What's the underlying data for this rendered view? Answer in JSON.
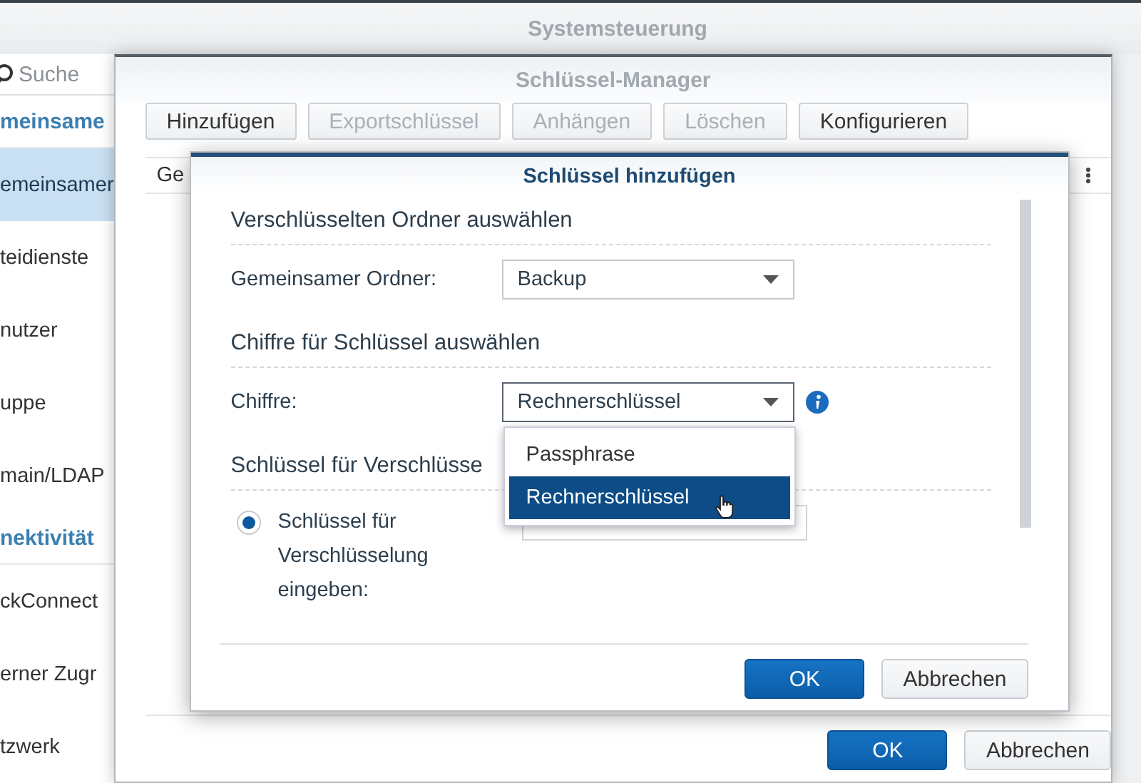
{
  "window": {
    "title": "Systemsteuerung"
  },
  "sidebar": {
    "search": {
      "placeholder": "Suche"
    },
    "items": [
      {
        "label": "meinsame",
        "kind": "header"
      },
      {
        "label": "emeinsamer",
        "kind": "item",
        "selected": true
      },
      {
        "label": "teidienste",
        "kind": "item",
        "selected": false
      },
      {
        "label": "nutzer",
        "kind": "item",
        "selected": false
      },
      {
        "label": "uppe",
        "kind": "item",
        "selected": false
      },
      {
        "label": "main/LDAP",
        "kind": "item",
        "selected": false
      },
      {
        "label": "nektivität",
        "kind": "header"
      },
      {
        "label": "ckConnect",
        "kind": "item",
        "selected": false
      },
      {
        "label": "erner Zugr",
        "kind": "item",
        "selected": false
      },
      {
        "label": "tzwerk",
        "kind": "item",
        "selected": false
      }
    ]
  },
  "key_manager": {
    "title": "Schlüssel-Manager",
    "toolbar": [
      {
        "label": "Hinzufügen",
        "disabled": false
      },
      {
        "label": "Exportschlüssel",
        "disabled": true
      },
      {
        "label": "Anhängen",
        "disabled": true
      },
      {
        "label": "Löschen",
        "disabled": true
      },
      {
        "label": "Konfigurieren",
        "disabled": false
      }
    ],
    "table": {
      "columns": [
        "Ge"
      ]
    },
    "buttons": [
      {
        "label": "OK",
        "kind": "primary"
      },
      {
        "label": "Abbrechen",
        "kind": "secondary"
      }
    ]
  },
  "dialog": {
    "title": "Schlüssel hinzufügen",
    "sections": [
      {
        "heading": "Verschlüsselten Ordner auswählen",
        "fields": [
          {
            "kind": "select",
            "label": "Gemeinsamer Ordner:",
            "value": "Backup",
            "open": false
          }
        ]
      },
      {
        "heading": "Chiffre für Schlüssel auswählen",
        "fields": [
          {
            "kind": "select",
            "label": "Chiffre:",
            "value": "Rechnerschlüssel",
            "info": true,
            "open": true,
            "options": [
              {
                "label": "Passphrase",
                "selected": false
              },
              {
                "label": "Rechnerschlüssel",
                "selected": true
              }
            ]
          }
        ]
      },
      {
        "heading": "Schlüssel für Verschlüsse",
        "fields": [
          {
            "kind": "radio",
            "label": "Schlüssel für Verschlüsselung eingeben:",
            "selected": true
          }
        ]
      }
    ],
    "buttons": [
      {
        "label": "OK",
        "kind": "primary"
      },
      {
        "label": "Abbrechen",
        "kind": "secondary"
      }
    ]
  }
}
